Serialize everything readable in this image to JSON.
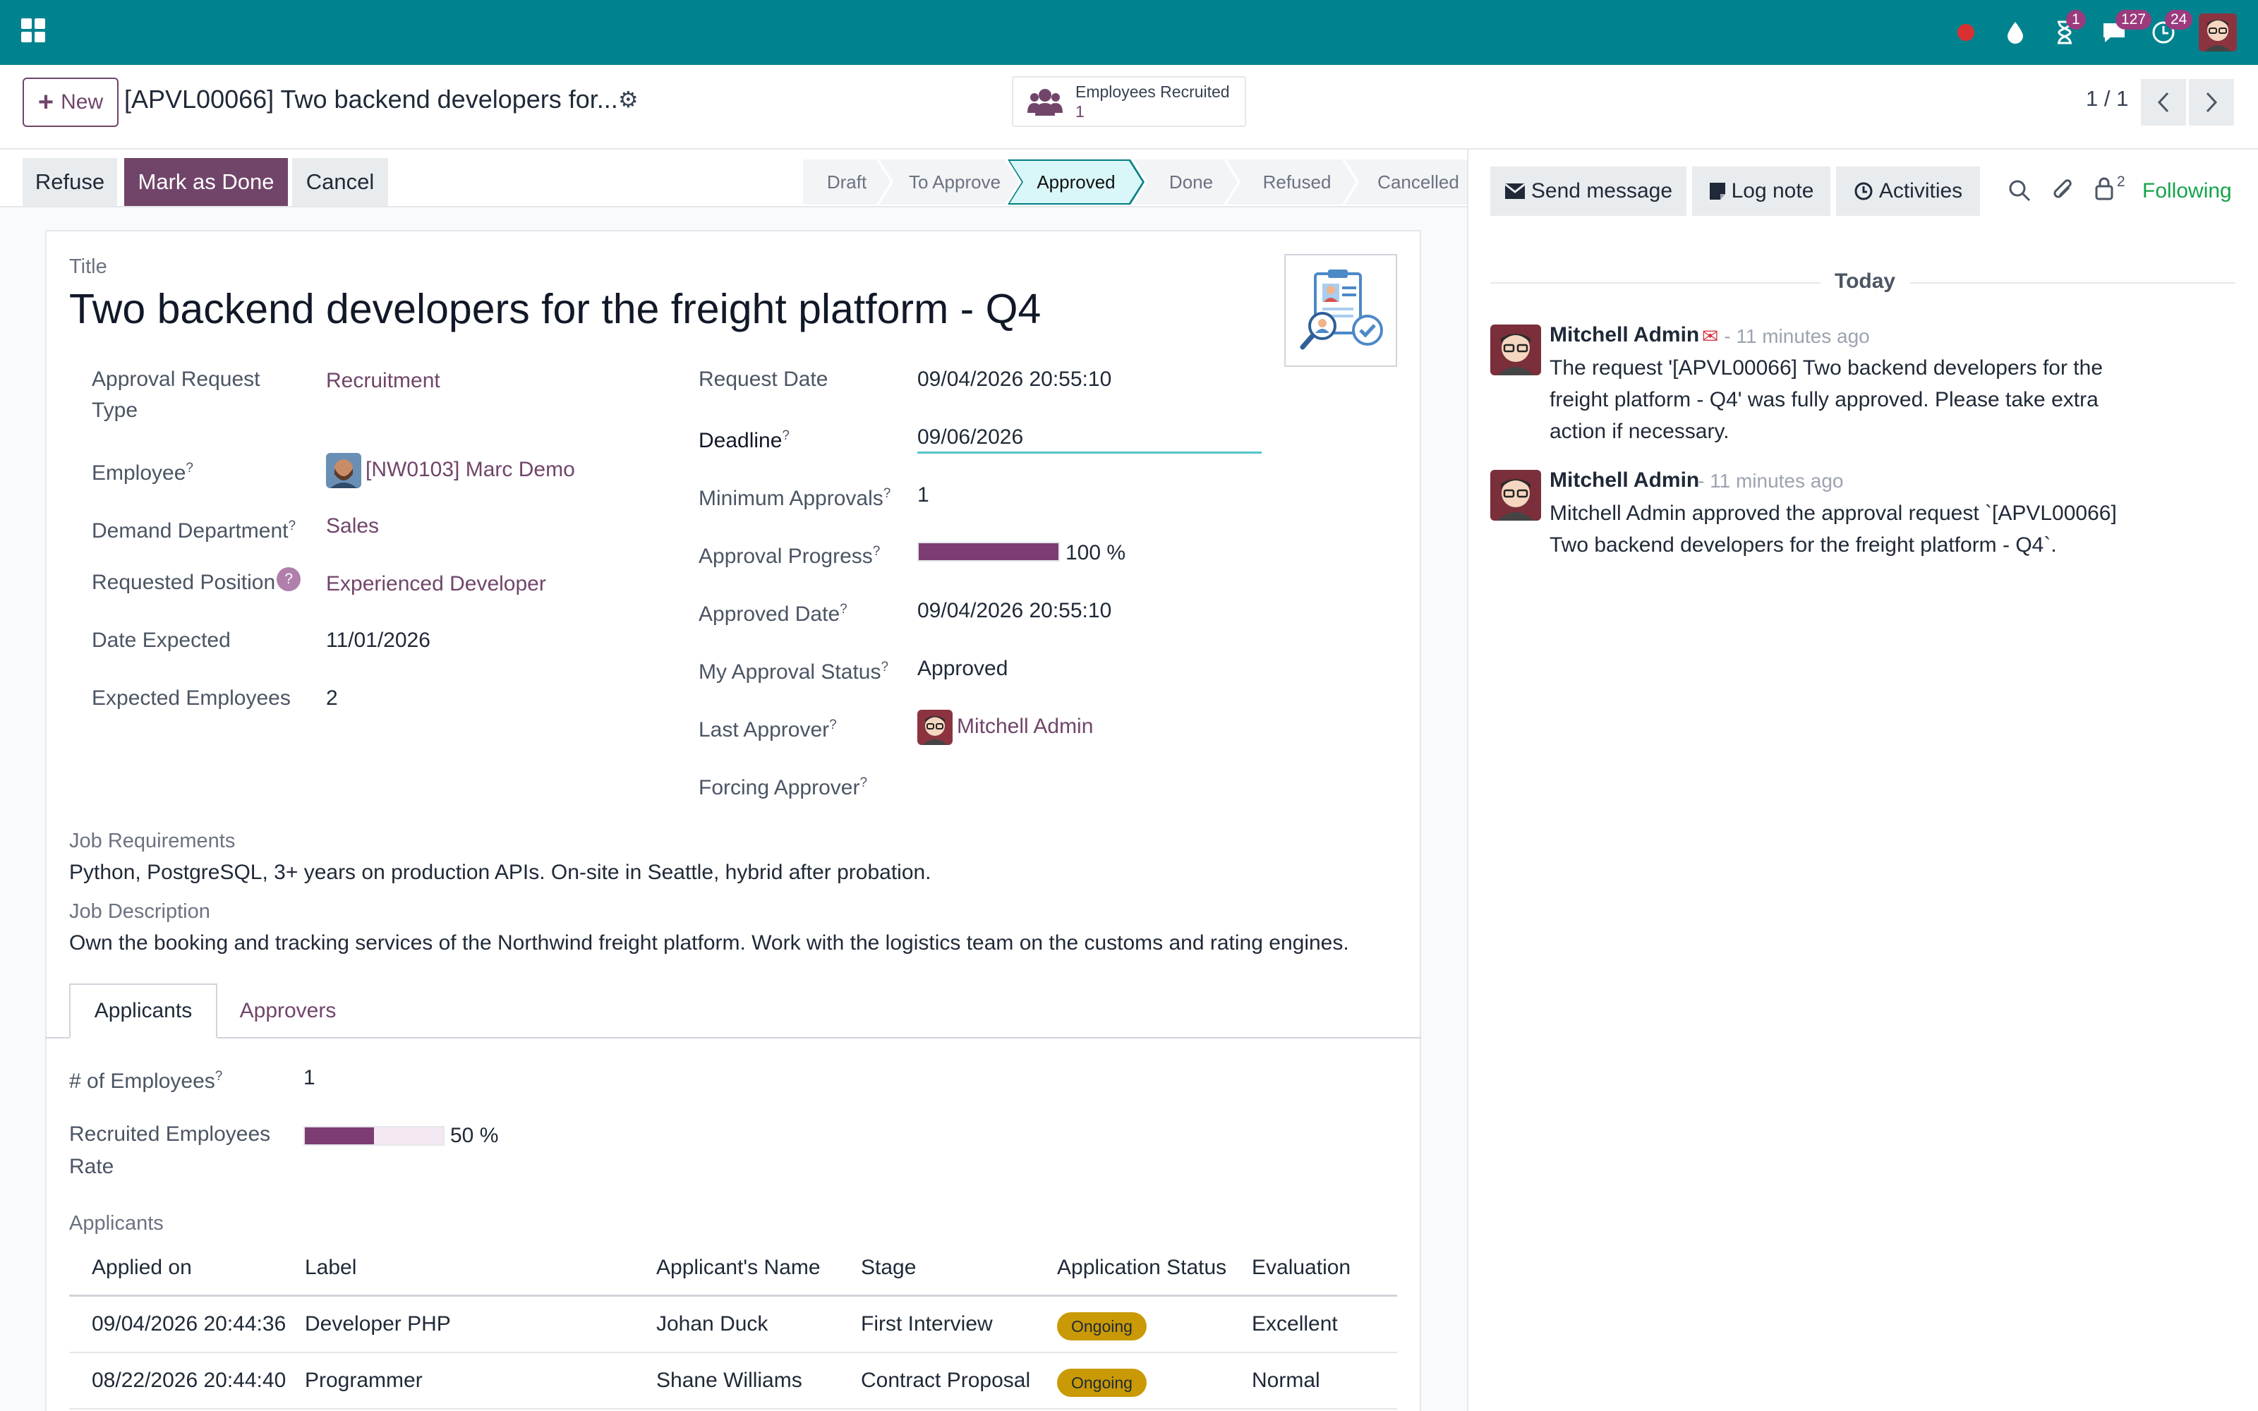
{
  "navbar": {
    "badges": {
      "activity": "1",
      "messages": "127",
      "clock": "24"
    }
  },
  "control": {
    "new_label": "New",
    "record_title": "[APVL00066] Two backend developers for...",
    "smart_button": {
      "label": "Employees Recruited",
      "value": "1"
    },
    "pager": "1 / 1"
  },
  "statusbar": {
    "buttons": [
      "Refuse",
      "Mark as Done",
      "Cancel"
    ],
    "stages": [
      "Draft",
      "To Approve",
      "Approved",
      "Done",
      "Refused",
      "Cancelled"
    ],
    "active_stage": "Approved"
  },
  "form": {
    "title_label": "Title",
    "title": "Two backend developers for the freight platform - Q4",
    "left": {
      "approval_type_label_1": "Approval Request",
      "approval_type_label_2": "Type",
      "approval_type": "Recruitment",
      "employee_label": "Employee",
      "employee": "[NW0103] Marc Demo",
      "department_label": "Demand Department",
      "department": "Sales",
      "position_label": "Requested Position",
      "position": "Experienced Developer",
      "date_expected_label": "Date Expected",
      "date_expected": "11/01/2026",
      "expected_employees_label": "Expected Employees",
      "expected_employees": "2"
    },
    "right": {
      "request_date_label": "Request Date",
      "request_date": "09/04/2026 20:55:10",
      "deadline_label": "Deadline",
      "deadline": "09/06/2026",
      "min_approvals_label": "Minimum Approvals",
      "min_approvals": "1",
      "progress_label": "Approval Progress",
      "progress_value": 100,
      "progress_text": "100 %",
      "approved_date_label": "Approved Date",
      "approved_date": "09/04/2026 20:55:10",
      "my_status_label": "My Approval Status",
      "my_status": "Approved",
      "last_approver_label": "Last Approver",
      "last_approver": "Mitchell Admin",
      "forcing_approver_label": "Forcing Approver"
    },
    "help_mark": "?",
    "requirements_label": "Job Requirements",
    "requirements": "Python, PostgreSQL, 3+ years on production APIs. On-site in Seattle, hybrid after probation.",
    "description_label": "Job Description",
    "description": "Own the booking and tracking services of the Northwind freight platform. Work with the logistics team on the customs and rating engines."
  },
  "tabs": [
    "Applicants",
    "Approvers"
  ],
  "applicants_tab": {
    "num_employees_label": "# of Employees",
    "num_employees": "1",
    "rate_label_1": "Recruited Employees",
    "rate_label_2": "Rate",
    "rate_value": 50,
    "rate_text": "50 %",
    "section_label": "Applicants",
    "columns": [
      "Applied on",
      "Label",
      "Applicant's Name",
      "Stage",
      "Application Status",
      "Evaluation"
    ],
    "rows": [
      {
        "applied_on": "09/04/2026 20:44:36",
        "label": "Developer PHP",
        "name": "Johan Duck",
        "stage": "First Interview",
        "status": "Ongoing",
        "evaluation": "Excellent"
      },
      {
        "applied_on": "08/22/2026 20:44:40",
        "label": "Programmer",
        "name": "Shane Williams",
        "stage": "Contract Proposal",
        "status": "Ongoing",
        "evaluation": "Normal"
      }
    ]
  },
  "chatter": {
    "send_message": "Send message",
    "log_note": "Log note",
    "activities": "Activities",
    "followers_count": "2",
    "following": "Following",
    "date_separator": "Today",
    "messages": [
      {
        "author": "Mitchell Admin",
        "meta": "- 11 minutes ago",
        "body": "The request '[APVL00066] Two backend developers for the freight platform - Q4' was fully approved. Please take extra action if necessary."
      },
      {
        "author": "Mitchell Admin",
        "meta": "- 11 minutes ago",
        "body": "Mitchell Admin approved the approval request `[APVL00066] Two backend developers for the freight platform - Q4`."
      }
    ]
  }
}
